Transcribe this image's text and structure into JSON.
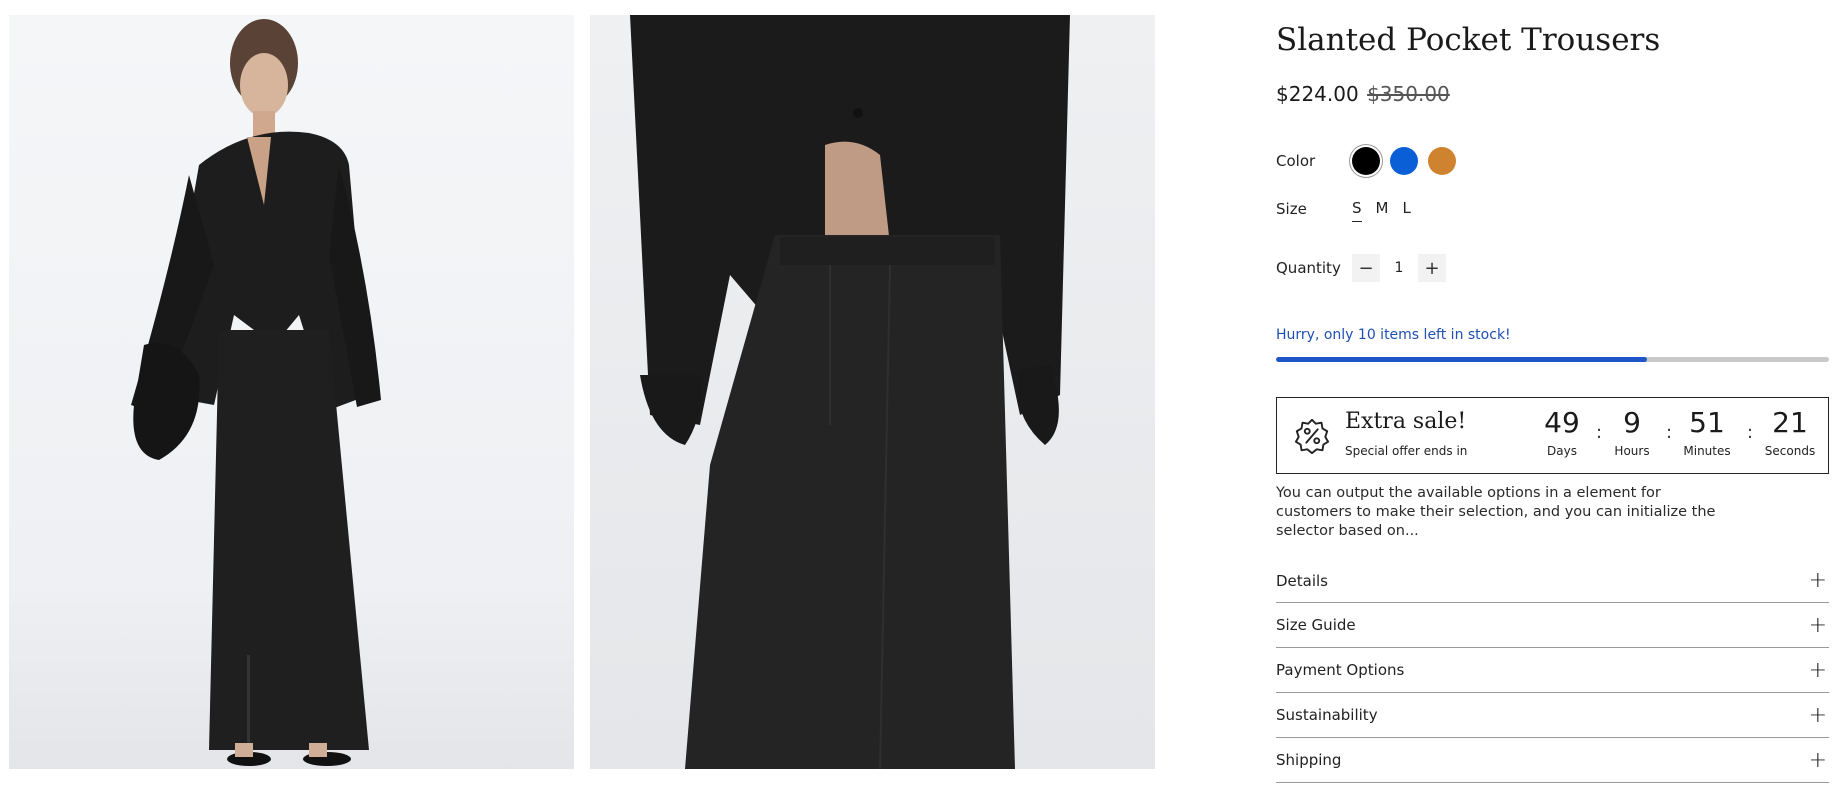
{
  "product": {
    "title": "Slanted Pocket Trousers",
    "price": "$224.00",
    "compare_price": "$350.00"
  },
  "options": {
    "color_label": "Color",
    "colors": [
      {
        "name": "Black",
        "hex": "#000000",
        "selected": true
      },
      {
        "name": "Blue",
        "hex": "#0b5fd6",
        "selected": false
      },
      {
        "name": "Orange",
        "hex": "#d0832f",
        "selected": false
      }
    ],
    "size_label": "Size",
    "sizes": [
      "S",
      "M",
      "L"
    ],
    "selected_size": "S"
  },
  "quantity": {
    "label": "Quantity",
    "value": "1",
    "minus_icon": "minus-icon",
    "plus_icon": "plus-icon"
  },
  "stock": {
    "message": "Hurry, only 10 items left in stock!",
    "progress_percent": 67,
    "bar_color": "#1e56c9"
  },
  "sale": {
    "icon": "discount-badge-icon",
    "title": "Extra sale!",
    "subtitle": "Special offer ends in",
    "countdown": [
      {
        "value": "49",
        "label": "Days"
      },
      {
        "value": "9",
        "label": "Hours"
      },
      {
        "value": "51",
        "label": "Minutes"
      },
      {
        "value": "21",
        "label": "Seconds"
      }
    ],
    "separator": ":"
  },
  "description": "You can output the available options in a element for customers to make their selection, and you can initialize the selector based on...",
  "accordion": [
    {
      "label": "Details",
      "icon": "plus-icon"
    },
    {
      "label": "Size Guide",
      "icon": "plus-icon"
    },
    {
      "label": "Payment Options",
      "icon": "plus-icon"
    },
    {
      "label": "Sustainability",
      "icon": "plus-icon"
    },
    {
      "label": "Shipping",
      "icon": "plus-icon"
    }
  ],
  "gallery": [
    {
      "image": "model-full-length-photo"
    },
    {
      "image": "model-skirt-closeup-photo"
    }
  ]
}
